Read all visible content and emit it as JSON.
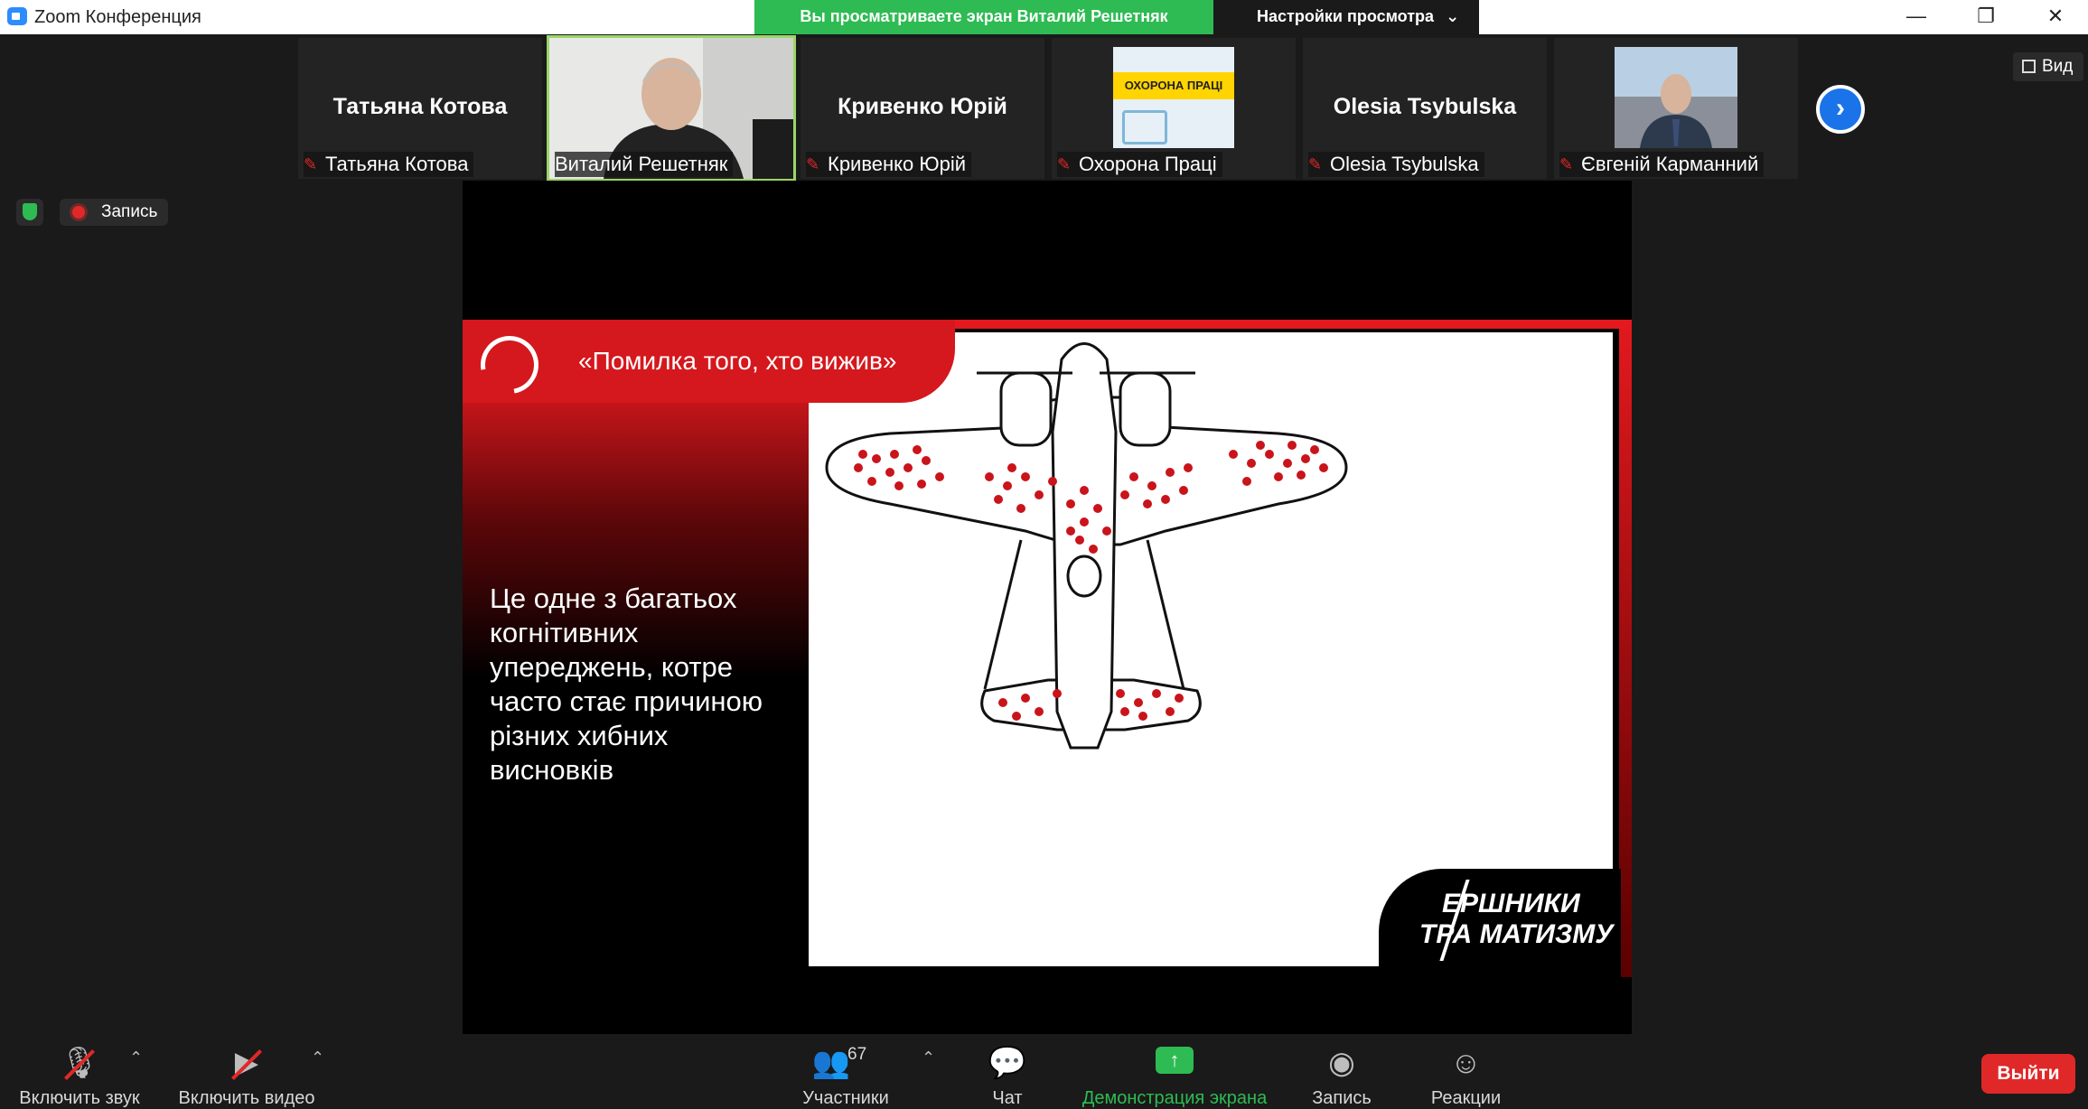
{
  "app": {
    "title": "Zoom Конференция"
  },
  "banner": {
    "sharing_text": "Вы просматриваете экран Виталий Решетняк",
    "view_options": "Настройки просмотра"
  },
  "window_controls": {
    "minimize": "—",
    "restore": "❐",
    "close": "✕"
  },
  "participants": [
    {
      "big_name": "Татьяна Котова",
      "label": "Татьяна Котова",
      "muted": true,
      "type": "name"
    },
    {
      "big_name": "",
      "label": "Виталий Решетняк",
      "muted": false,
      "type": "video",
      "active": true
    },
    {
      "big_name": "Кривенко Юрій",
      "label": "Кривенко Юрій",
      "muted": true,
      "type": "name"
    },
    {
      "big_name": "",
      "label": "Охорона Праці",
      "muted": true,
      "type": "image",
      "image_text": "ОХОРОНА ПРАЦІ"
    },
    {
      "big_name": "Olesia Tsybulska",
      "label": "Olesia Tsybulska",
      "muted": true,
      "type": "name"
    },
    {
      "big_name": "",
      "label": "Євгеній Карманний",
      "muted": true,
      "type": "video"
    }
  ],
  "view_button": {
    "label": "Вид"
  },
  "recording": {
    "label": "Запись"
  },
  "slide": {
    "title": "«Помилка того, хто вижив»",
    "body": "Це одне з багатьох когнітивних упереджень, котре часто стає причиною різних хибних висновків",
    "brand_line1": "ЕРШНИКИ",
    "brand_line2": "ТРА МАТИЗМУ",
    "accent_color": "#e3191e"
  },
  "toolbar": {
    "audio": "Включить звук",
    "video": "Включить видео",
    "participants": "Участники",
    "participants_count": "67",
    "chat": "Чат",
    "share": "Демонстрация экрана",
    "record": "Запись",
    "reactions": "Реакции",
    "leave": "Выйти"
  }
}
